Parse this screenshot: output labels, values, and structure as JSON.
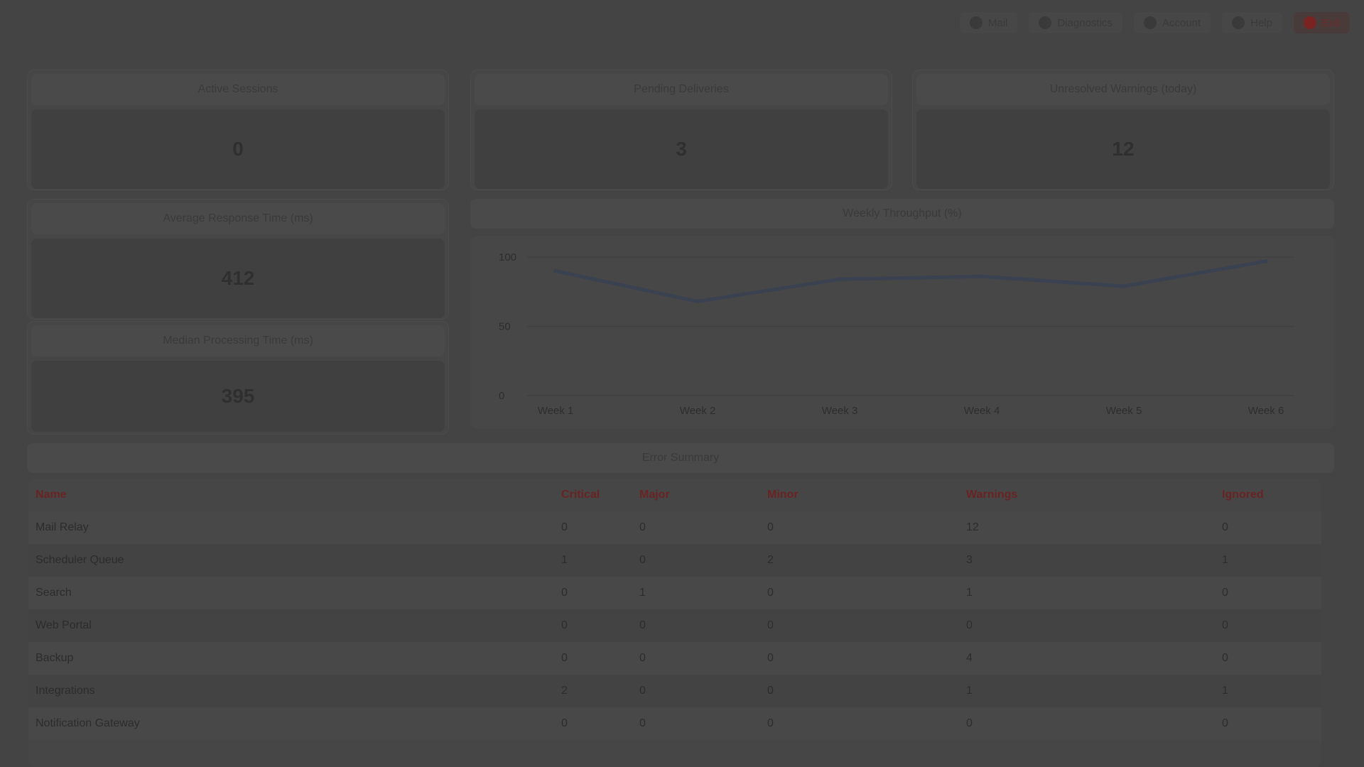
{
  "nav": {
    "items": [
      {
        "label": "Mail",
        "icon": "mail-icon"
      },
      {
        "label": "Diagnostics",
        "icon": "chart-icon"
      },
      {
        "label": "Account",
        "icon": "user-icon"
      },
      {
        "label": "Help",
        "icon": "help-icon"
      },
      {
        "label": "Exit",
        "icon": "power-icon",
        "danger": true
      }
    ]
  },
  "stats": {
    "card1": {
      "title": "Active Sessions",
      "value": "0"
    },
    "card2": {
      "title": "Pending Deliveries",
      "value": "3"
    },
    "card3": {
      "title": "Unresolved Warnings (today)",
      "value": "12"
    },
    "card4": {
      "title": "Average Response Time (ms)",
      "value": "412"
    },
    "card5": {
      "title": "Median Processing Time (ms)",
      "value": "395"
    }
  },
  "chart_section": {
    "title": "Weekly Throughput (%)"
  },
  "chart_data": {
    "type": "line",
    "categories": [
      "Week 1",
      "Week 2",
      "Week 3",
      "Week 4",
      "Week 5",
      "Week 6"
    ],
    "series": [
      {
        "values": [
          90,
          68,
          84,
          86,
          79,
          97
        ]
      }
    ],
    "yticks": [
      "100",
      "50",
      "0"
    ],
    "ylim": [
      0,
      100
    ],
    "grid": true,
    "colors": {
      "line": "#3a4150"
    }
  },
  "table": {
    "title": "Error Summary",
    "columns": [
      "Name",
      "Critical",
      "Major",
      "Minor",
      "Warnings",
      "Ignored"
    ],
    "rows": [
      [
        "Mail Relay",
        "0",
        "0",
        "0",
        "12",
        "0"
      ],
      [
        "Scheduler Queue",
        "1",
        "0",
        "2",
        "3",
        "1"
      ],
      [
        "Search",
        "0",
        "1",
        "0",
        "1",
        "0"
      ],
      [
        "Web Portal",
        "0",
        "0",
        "0",
        "0",
        "0"
      ],
      [
        "Backup",
        "0",
        "0",
        "0",
        "4",
        "0"
      ],
      [
        "Integrations",
        "2",
        "0",
        "0",
        "1",
        "1"
      ],
      [
        "Notification Gateway",
        "0",
        "0",
        "0",
        "0",
        "0"
      ]
    ]
  }
}
